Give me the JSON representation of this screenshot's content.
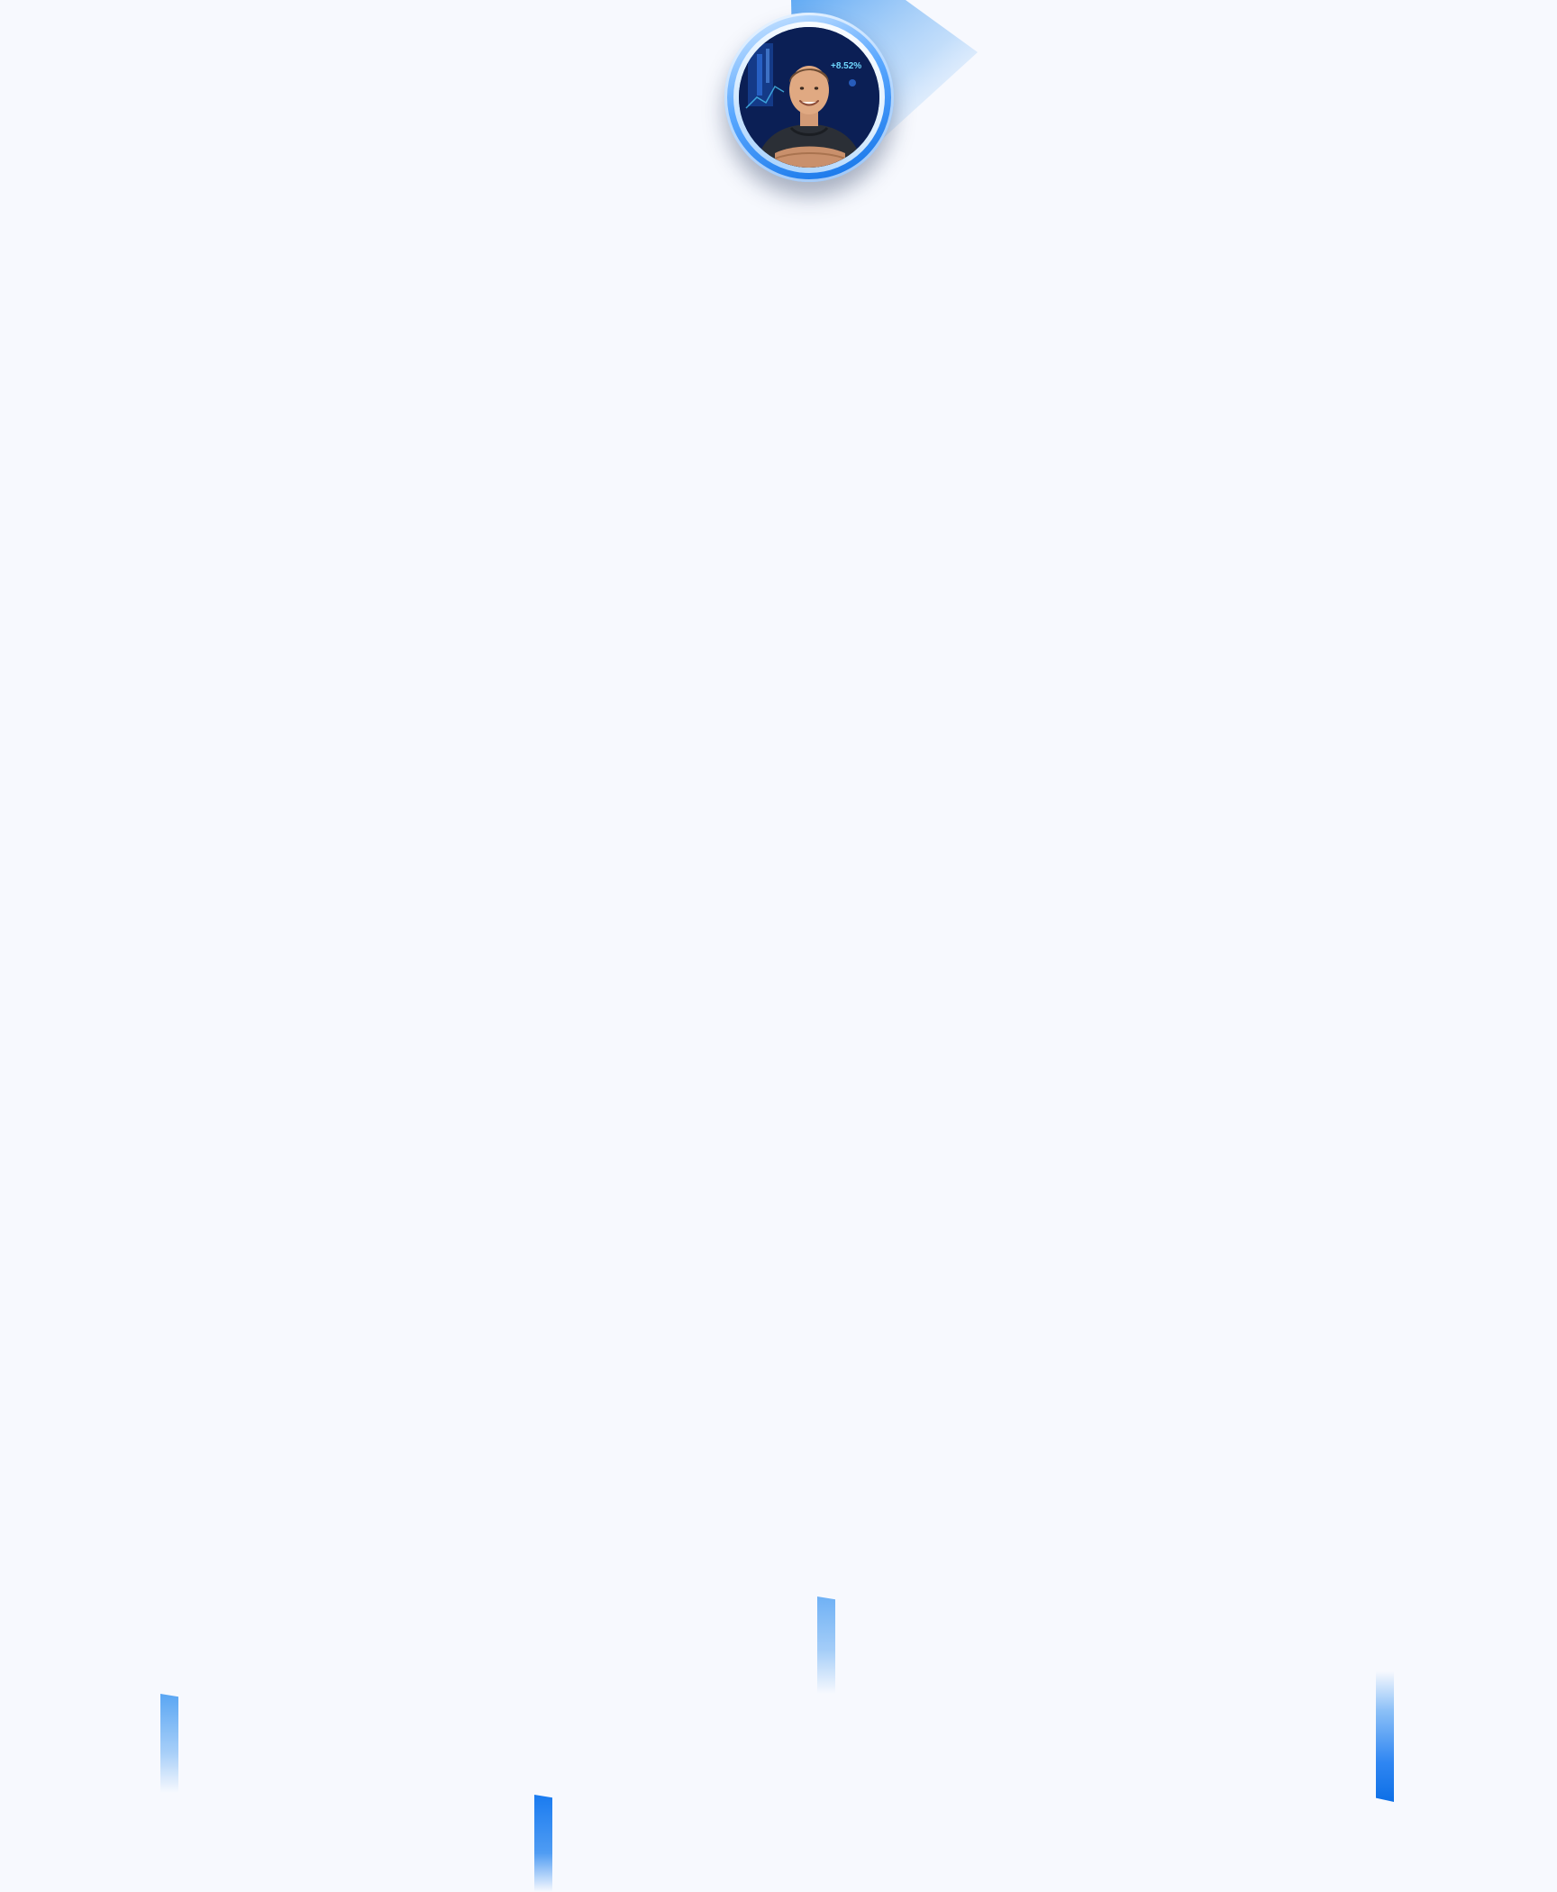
{
  "header": {
    "avatar": {
      "alt_text": "",
      "photo_overlay_text": "+8.52%"
    }
  },
  "colors": {
    "background": "#f7f9fe",
    "accent": "#0d6fe6",
    "accent_light": "#5aa6f3"
  }
}
